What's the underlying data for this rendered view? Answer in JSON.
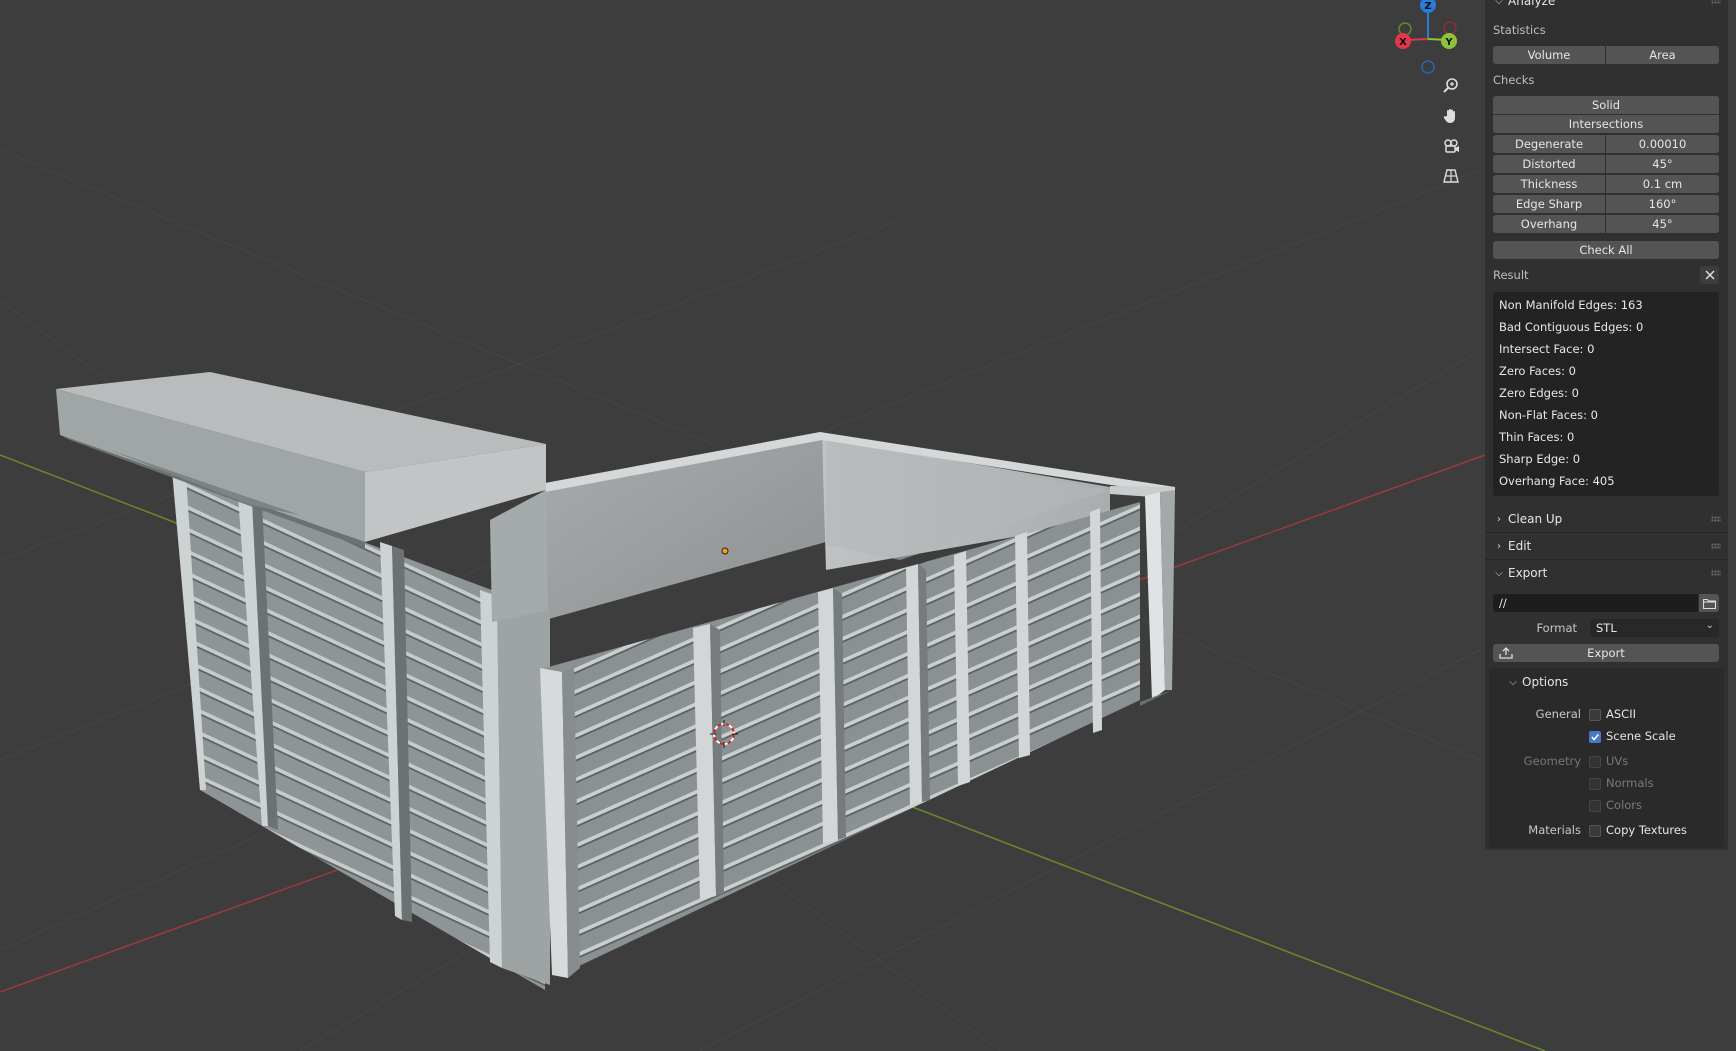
{
  "panel": {
    "analyze": {
      "title": "Analyze",
      "statistics_label": "Statistics",
      "volume_button": "Volume",
      "area_button": "Area",
      "checks_label": "Checks",
      "solid_button": "Solid",
      "intersections_button": "Intersections",
      "params": [
        {
          "label": "Degenerate",
          "value": "0.00010"
        },
        {
          "label": "Distorted",
          "value": "45°"
        },
        {
          "label": "Thickness",
          "value": "0.1 cm"
        },
        {
          "label": "Edge Sharp",
          "value": "160°"
        },
        {
          "label": "Overhang",
          "value": "45°"
        }
      ],
      "check_all_button": "Check All",
      "result_label": "Result",
      "results": [
        "Non Manifold Edges: 163",
        "Bad Contiguous Edges: 0",
        "Intersect Face: 0",
        "Zero Faces: 0",
        "Zero Edges: 0",
        "Non-Flat Faces: 0",
        "Thin Faces: 0",
        "Sharp Edge: 0",
        "Overhang Face: 405"
      ]
    },
    "clean_up": {
      "title": "Clean Up"
    },
    "edit": {
      "title": "Edit"
    },
    "export": {
      "title": "Export",
      "path_value": "//",
      "format_label": "Format",
      "format_value": "STL",
      "export_button": "Export",
      "options": {
        "title": "Options",
        "general_label": "General",
        "ascii": {
          "label": "ASCII",
          "checked": false
        },
        "scene_scale": {
          "label": "Scene Scale",
          "checked": true
        },
        "geometry_label": "Geometry",
        "uvs": {
          "label": "UVs",
          "checked": false
        },
        "normals": {
          "label": "Normals",
          "checked": false
        },
        "colors": {
          "label": "Colors",
          "checked": false
        },
        "materials_label": "Materials",
        "copy_textures": {
          "label": "Copy Textures",
          "checked": false
        }
      }
    }
  },
  "gizmo": {
    "x_label": "X",
    "y_label": "Y",
    "z_label": "Z",
    "colors": {
      "x": "#e2364a",
      "y": "#8bc43a",
      "z": "#2b7bdb"
    }
  },
  "viewport_tools": [
    "zoom-icon",
    "hand-pan-icon",
    "camera-icon",
    "grid-perspective-icon"
  ],
  "colors": {
    "viewport_bg": "#3d3d3d",
    "panel_bg": "#303030",
    "field_bg": "#545454",
    "checkbox_on": "#4a78c4",
    "x_axis_line": "#9a3a3a",
    "y_axis_line": "#6a8a2a"
  }
}
